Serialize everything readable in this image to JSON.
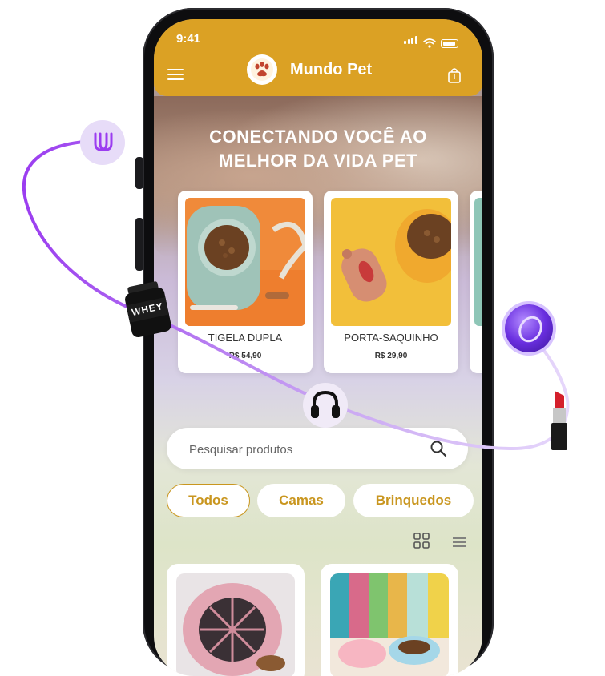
{
  "status_bar": {
    "time": "9:41"
  },
  "header": {
    "app_title": "Mundo Pet"
  },
  "hero": {
    "line1": "CONECTANDO VOCÊ AO",
    "line2": "MELHOR DA VIDA PET"
  },
  "products": [
    {
      "name": "TIGELA DUPLA",
      "price": "R$ 54,90"
    },
    {
      "name": "PORTA-SAQUINHO",
      "price": "R$ 29,90"
    }
  ],
  "search": {
    "placeholder": "Pesquisar produtos"
  },
  "filters": [
    {
      "label": "Todos",
      "active": true
    },
    {
      "label": "Camas",
      "active": false
    },
    {
      "label": "Brinquedos",
      "active": false
    }
  ],
  "decor": {
    "whey_label": "WHEY"
  },
  "colors": {
    "accent": "#DBA124",
    "chip_text": "#C9961F",
    "orbit": "#A855F7"
  },
  "icons": [
    "menu-icon",
    "paw-logo-icon",
    "shopping-bag-icon",
    "search-icon",
    "grid-view-icon",
    "list-view-icon"
  ]
}
